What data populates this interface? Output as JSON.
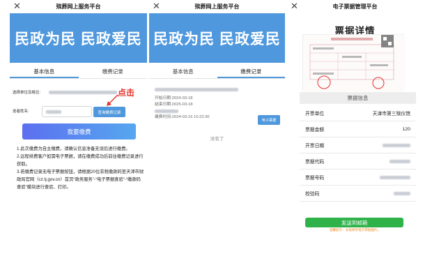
{
  "panel1": {
    "title": "殡葬网上服务平台",
    "banner": "民政为民  民政爱民",
    "tabs": [
      "基本信息",
      "缴费记录"
    ],
    "unit_label": "选择单位及格位:",
    "payer_label": "逝者姓名:",
    "query_button": "查询缴费记录",
    "click_hint": "点击",
    "pay_button": "我要缴费",
    "notes": [
      "1.此次缴费为自主缴费，请确认信息准备无误后进行缴费。",
      "2.远程续费客户如需电子票据，请在缴费成功后前往缴费记录进行获取。",
      "3.若缴费记录无电子票据按钮，请根据20位非税缴款码至天津市财政局官网（cz.tj.gov.cn）首页“政务服务”-“电子票据查验”-“缴款码查验”模块进行查验、打印。"
    ]
  },
  "panel2": {
    "title": "殡葬网上服务平台",
    "banner": "民政为民  民政爱民",
    "tabs": [
      "基本信息",
      "缴费记录"
    ],
    "record": {
      "start_date": "开始日期:2024-03-18",
      "end_date": "结束日期:2025-03-18",
      "pay_time": "缴费时间:2024-03-15 10:22:30"
    },
    "einvoice_button": "电子票据",
    "no_more": "没有了"
  },
  "panel3": {
    "title": "电子票据管理平台",
    "heading": "票据详情",
    "section": "票据信息",
    "rows": [
      {
        "label": "开票单位",
        "value": "天津市第三殡仪馆"
      },
      {
        "label": "票据金额",
        "value": "120"
      },
      {
        "label": "开票日期",
        "value": ""
      },
      {
        "label": "票据代码",
        "value": ""
      },
      {
        "label": "票据号码",
        "value": ""
      },
      {
        "label": "校验码",
        "value": ""
      }
    ],
    "send_button": "发送到邮箱",
    "tip": "温馨提示：长按保存电子票据图片。"
  },
  "icons": {
    "close": "close-icon",
    "arrow": "arrow-icon"
  },
  "colors": {
    "banner": "#4f98dd",
    "accent_red": "#e4332d",
    "send_green": "#2fb24a",
    "tip_orange": "#f08a24"
  }
}
